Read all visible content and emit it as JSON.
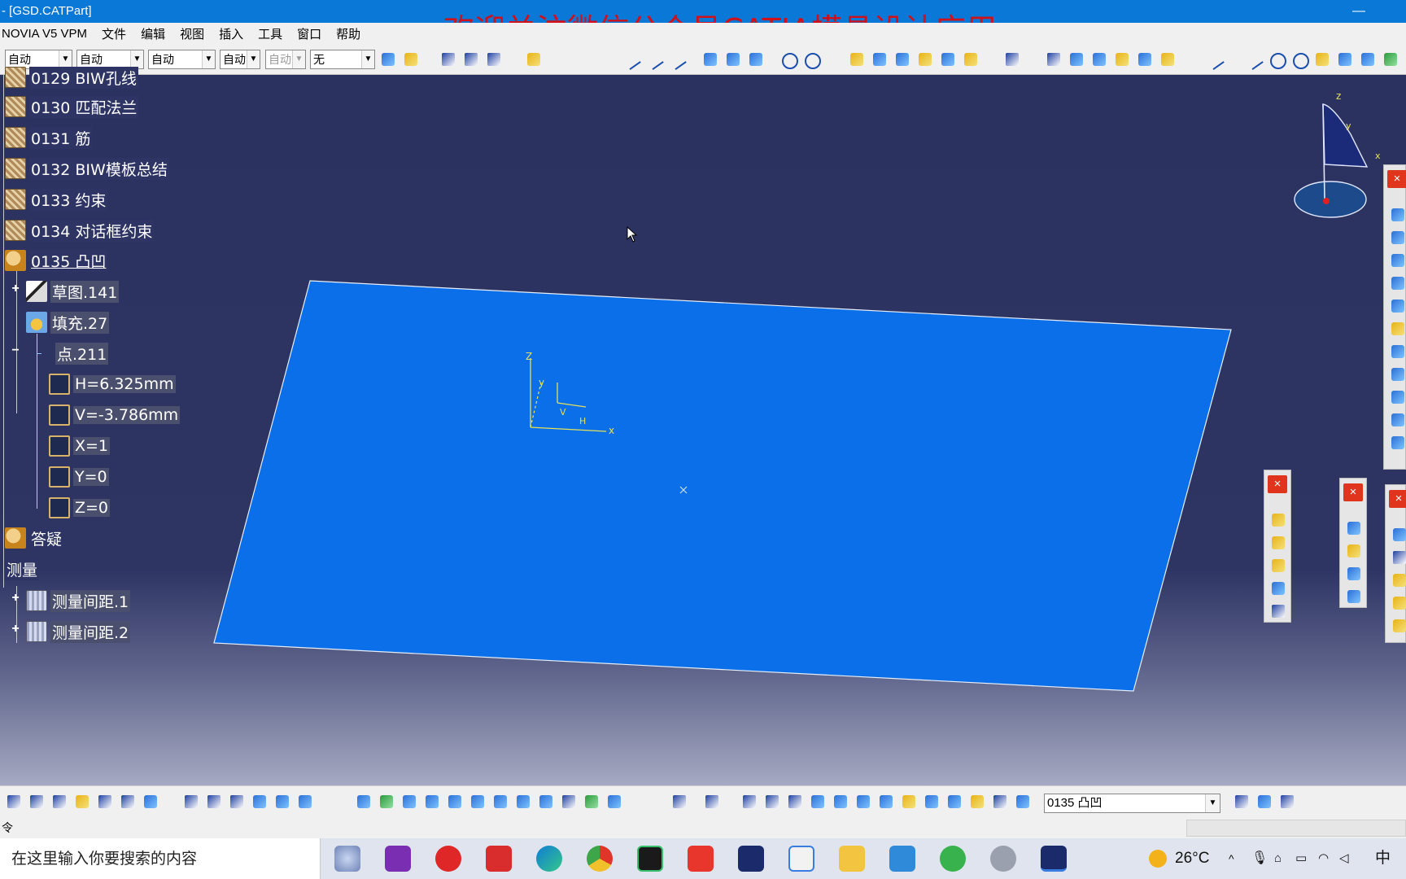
{
  "window": {
    "title": "- [GSD.CATPart]",
    "minimize": "—",
    "maximize": "☐"
  },
  "watermark": "欢迎关注微信公众号CATIA模具设计应用",
  "menu": [
    "NOVIA V5 VPM",
    "文件",
    "编辑",
    "视图",
    "插入",
    "工具",
    "窗口",
    "帮助"
  ],
  "toolbar": {
    "combos": [
      {
        "value": "自动"
      },
      {
        "value": "自动"
      },
      {
        "value": "自动"
      },
      {
        "value": "自动"
      },
      {
        "value": "自动"
      },
      {
        "value": "无"
      }
    ]
  },
  "tree": {
    "items": [
      {
        "label": "0129 BIW孔线"
      },
      {
        "label": "0130 匹配法兰"
      },
      {
        "label": "0131 筋"
      },
      {
        "label": "0132 BIW模板总结"
      },
      {
        "label": "0133 约束"
      },
      {
        "label": "0134 对话框约束"
      },
      {
        "label": "0135 凸凹"
      },
      {
        "label": "草图.141"
      },
      {
        "label": "填充.27"
      },
      {
        "label": "点.211"
      },
      {
        "label": "H=6.325mm"
      },
      {
        "label": "V=-3.786mm"
      },
      {
        "label": "X=1"
      },
      {
        "label": "Y=0"
      },
      {
        "label": "Z=0"
      },
      {
        "label": "答疑"
      },
      {
        "label": "测量"
      },
      {
        "label": "测量间距.1"
      },
      {
        "label": "测量间距.2"
      }
    ]
  },
  "viewport": {
    "plane_color": "#0a6fe8",
    "background_top": "#2e3564",
    "axis_labels": {
      "z": "Z",
      "y": "y",
      "x": "x",
      "h": "H",
      "v": "V"
    },
    "compass_labels": {
      "z": "z",
      "y": "y",
      "x": "x"
    }
  },
  "panels": {
    "close": "×"
  },
  "bottom_toolbar": {
    "selection_value": "0135 凸凹"
  },
  "status": {
    "prompt": "令"
  },
  "taskbar": {
    "search_placeholder": "在这里输入你要搜索的内容",
    "temperature": "26°C",
    "ime": "中"
  }
}
